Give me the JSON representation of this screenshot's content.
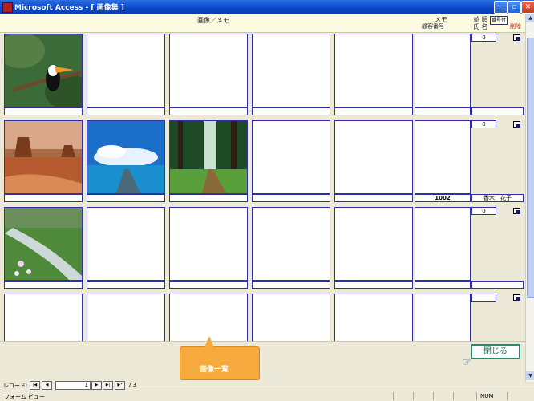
{
  "window": {
    "title": "Microsoft Access - [ 画像集 ]"
  },
  "header": {
    "main_label": "画像／メモ",
    "memo_label": "メモ",
    "customer_label": "顧客番号",
    "order_label": "並 順",
    "order_button": "番号付",
    "name_label": "氏 名",
    "delete_label": "削除"
  },
  "records": [
    {
      "seq": "0",
      "customer_no": "",
      "name": "",
      "images": [
        "toucan",
        "",
        "",
        "",
        ""
      ]
    },
    {
      "seq": "0",
      "customer_no": "1002",
      "name": "香木　花子",
      "images": [
        "desert-butte",
        "ocean-pier",
        "forest-path",
        "",
        ""
      ]
    },
    {
      "seq": "0",
      "customer_no": "",
      "name": "",
      "images": [
        "meadow-stream",
        "",
        "",
        "",
        ""
      ]
    },
    {
      "seq": "",
      "customer_no": "",
      "name": "",
      "images": [
        "",
        "",
        "",
        "",
        ""
      ]
    }
  ],
  "footer": {
    "tag_text": "画像一覧",
    "close_button": "閉じる"
  },
  "navigation": {
    "label": "レコード:",
    "current": "1",
    "total": "/ 3"
  },
  "status": {
    "view": "フォーム ビュー",
    "num": "NUM"
  },
  "colors": {
    "titlebar": "#0a47c7",
    "cell_border": "#3030a0",
    "tag": "#f6a93c",
    "delete_text": "#d00000"
  }
}
